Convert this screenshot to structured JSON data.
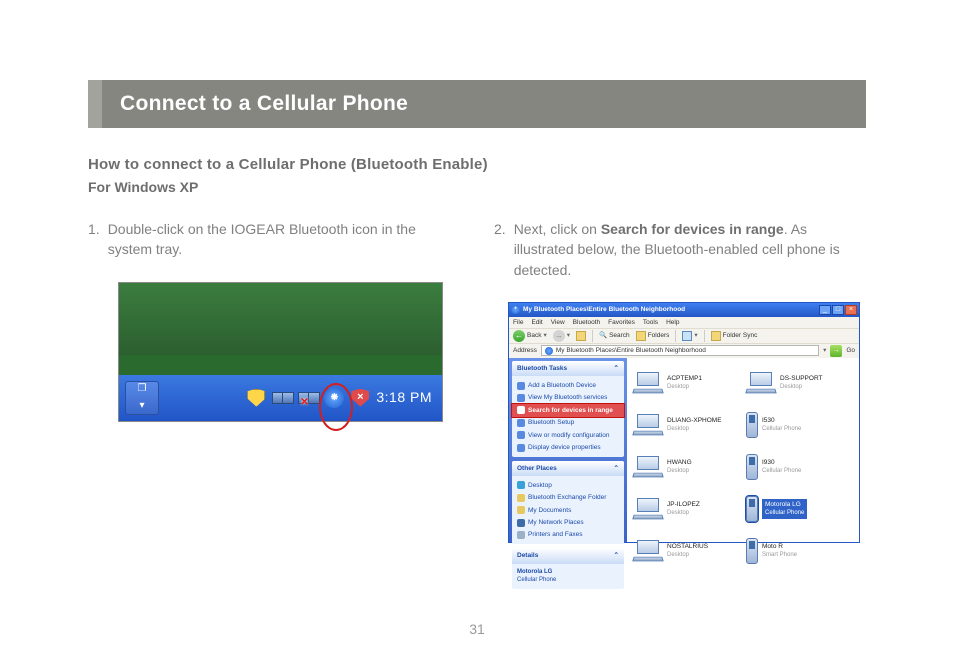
{
  "title": "Connect to a Cellular Phone",
  "section_heading": "How to connect to a Cellular Phone (Bluetooth Enable)",
  "os_heading": "For Windows XP",
  "steps": {
    "s1": {
      "num": "1.",
      "text": "Double-click on the IOGEAR Bluetooth icon in the system tray."
    },
    "s2": {
      "num": "2.",
      "prefix": "Next, click on ",
      "bold": "Search for devices in range",
      "suffix": ". As illustrated below, the Bluetooth-enabled cell phone is detected."
    }
  },
  "tray": {
    "time": "3:18 PM",
    "taskbtn_glyph_top": "❐",
    "taskbtn_glyph_bottom": "▾"
  },
  "window": {
    "title": "My Bluetooth Places\\Entire Bluetooth Neighborhood",
    "menubar": [
      "File",
      "Edit",
      "View",
      "Bluetooth",
      "Favorites",
      "Tools",
      "Help"
    ],
    "toolbar": {
      "back": "Back",
      "search": "Search",
      "folders": "Folders",
      "foldersync": "Folder Sync"
    },
    "address_label": "Address",
    "address_value": "My Bluetooth Places\\Entire Bluetooth Neighborhood",
    "go": "Go",
    "sidebar": {
      "tasks_header": "Bluetooth Tasks",
      "tasks": [
        "Add a Bluetooth Device",
        "View My Bluetooth services",
        "Search for devices in range",
        "Bluetooth Setup",
        "View or modify configuration",
        "Display device properties"
      ],
      "places_header": "Other Places",
      "places": [
        "Desktop",
        "Bluetooth Exchange Folder",
        "My Documents",
        "My Network Places",
        "Printers and Faxes"
      ],
      "details_header": "Details",
      "details_name": "Motorola LG",
      "details_type": "Cellular Phone"
    },
    "devices": [
      {
        "name": "ACPTEMP1",
        "type": "Desktop",
        "kind": "laptop"
      },
      {
        "name": "DS-SUPPORT",
        "type": "Desktop",
        "kind": "laptop"
      },
      {
        "name": "DLIANG-XPHOME",
        "type": "Desktop",
        "kind": "laptop"
      },
      {
        "name": "I530",
        "type": "Cellular Phone",
        "kind": "phone"
      },
      {
        "name": "HWANG",
        "type": "Desktop",
        "kind": "laptop"
      },
      {
        "name": "I930",
        "type": "Cellular Phone",
        "kind": "phone"
      },
      {
        "name": "JP-ILOPEZ",
        "type": "Desktop",
        "kind": "laptop"
      },
      {
        "name": "Motorola LG",
        "type": "Cellular Phone",
        "kind": "phone",
        "selected": true
      },
      {
        "name": "NOSTALRIUS",
        "type": "Desktop",
        "kind": "laptop"
      },
      {
        "name": "Moto R",
        "type": "Smart Phone",
        "kind": "phone"
      }
    ]
  },
  "page_number": "31"
}
